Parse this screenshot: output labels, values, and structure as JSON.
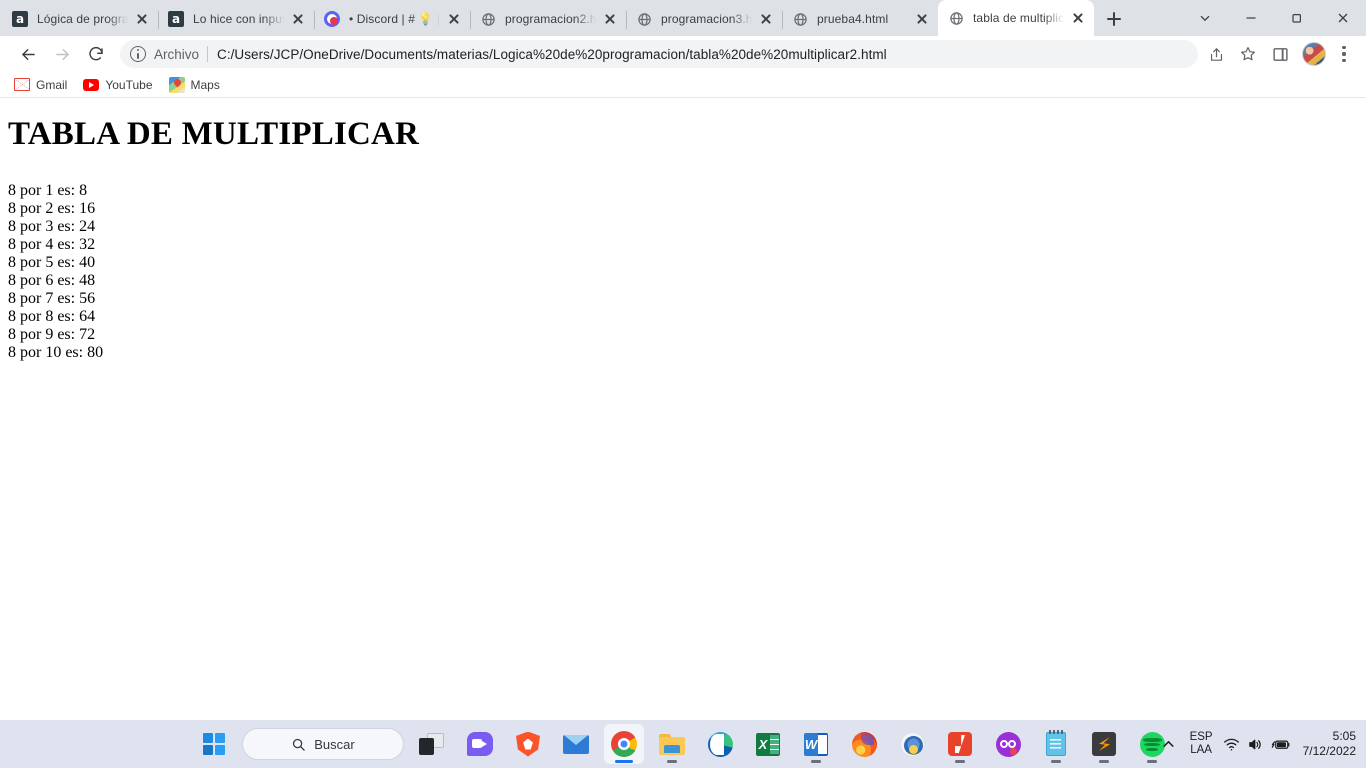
{
  "browser": {
    "tabs": [
      {
        "title": "Lógica de progra",
        "favicon": "moodle-a-icon",
        "active": false
      },
      {
        "title": "Lo hice con input",
        "favicon": "moodle-a-icon",
        "active": false
      },
      {
        "title": "• Discord | # 💡 |e",
        "favicon": "discord-icon",
        "active": false
      },
      {
        "title": "programacion2.h",
        "favicon": "globe-icon",
        "active": false
      },
      {
        "title": "programacion3.h",
        "favicon": "globe-icon",
        "active": false
      },
      {
        "title": "prueba4.html",
        "favicon": "globe-icon",
        "active": false
      },
      {
        "title": "tabla de multiplic",
        "favicon": "globe-icon",
        "active": true
      }
    ],
    "new_tab_label": "+",
    "window_controls": {
      "list_all_tabs": "chevron-down-icon",
      "minimize": "minimize-icon",
      "maximize": "maximize-icon",
      "close": "close-icon"
    },
    "toolbar": {
      "back": "back-arrow-icon",
      "forward": "forward-arrow-icon",
      "reload": "reload-icon",
      "scheme_label": "Archivo",
      "url": "C:/Users/JCP/OneDrive/Documents/materias/Logica%20de%20programacion/tabla%20de%20multiplicar2.html",
      "share": "share-icon",
      "bookmark": "star-icon",
      "side_panel": "side-panel-icon",
      "profile": "avatar-icon",
      "menu": "three-dots-icon"
    },
    "bookmarks": [
      {
        "label": "Gmail",
        "icon": "gmail-icon"
      },
      {
        "label": "YouTube",
        "icon": "youtube-icon"
      },
      {
        "label": "Maps",
        "icon": "maps-icon"
      }
    ]
  },
  "page": {
    "heading": "TABLA DE MULTIPLICAR",
    "lines": [
      "8 por 1 es: 8",
      "8 por 2 es: 16",
      "8 por 3 es: 24",
      "8 por 4 es: 32",
      "8 por 5 es: 40",
      "8 por 6 es: 48",
      "8 por 7 es: 56",
      "8 por 8 es: 64",
      "8 por 9 es: 72",
      "8 por 10 es: 80"
    ]
  },
  "taskbar": {
    "search_placeholder": "Buscar",
    "items": [
      {
        "name": "start-button",
        "icon": "windows-start-icon",
        "running": false,
        "active": false
      },
      {
        "name": "search-pill",
        "icon": "search-icon",
        "running": false,
        "active": false
      },
      {
        "name": "task-view-button",
        "icon": "task-view-icon",
        "running": false,
        "active": false
      },
      {
        "name": "chat-button",
        "icon": "chat-icon",
        "running": false,
        "active": false
      },
      {
        "name": "brave-button",
        "icon": "brave-icon",
        "running": false,
        "active": false
      },
      {
        "name": "mail-button",
        "icon": "mail-icon",
        "running": false,
        "active": false
      },
      {
        "name": "chrome-button",
        "icon": "chrome-icon",
        "running": true,
        "active": true
      },
      {
        "name": "file-explorer-button",
        "icon": "folder-icon",
        "running": true,
        "active": false
      },
      {
        "name": "edge-button",
        "icon": "edge-icon",
        "running": false,
        "active": false
      },
      {
        "name": "excel-button",
        "icon": "excel-icon",
        "running": false,
        "active": false
      },
      {
        "name": "word-button",
        "icon": "word-icon",
        "running": true,
        "active": false
      },
      {
        "name": "firefox-button",
        "icon": "firefox-icon",
        "running": false,
        "active": false
      },
      {
        "name": "circle-app-button",
        "icon": "circle-app-icon",
        "running": false,
        "active": false
      },
      {
        "name": "red-app-button",
        "icon": "red-app-icon",
        "running": true,
        "active": false
      },
      {
        "name": "purple-app-button",
        "icon": "purple-app-icon",
        "running": false,
        "active": false
      },
      {
        "name": "notepad-button",
        "icon": "notepad-icon",
        "running": true,
        "active": false
      },
      {
        "name": "sublime-text-button",
        "icon": "sublime-text-icon",
        "running": true,
        "active": false
      },
      {
        "name": "spotify-button",
        "icon": "spotify-icon",
        "running": true,
        "active": false
      }
    ],
    "tray": {
      "show_hidden_icons": "chevron-up-icon",
      "language_line1": "ESP",
      "language_line2": "LAA",
      "wifi": "wifi-icon",
      "volume": "volume-icon",
      "battery": "battery-charging-icon",
      "time": "5:05",
      "date": "7/12/2022"
    }
  },
  "colors": {
    "tab_strip": "#dee1e6",
    "toolbar": "#ffffff",
    "omnibox": "#f1f3f4",
    "taskbar": "#dfe2ef",
    "accent": "#1a73e8"
  }
}
